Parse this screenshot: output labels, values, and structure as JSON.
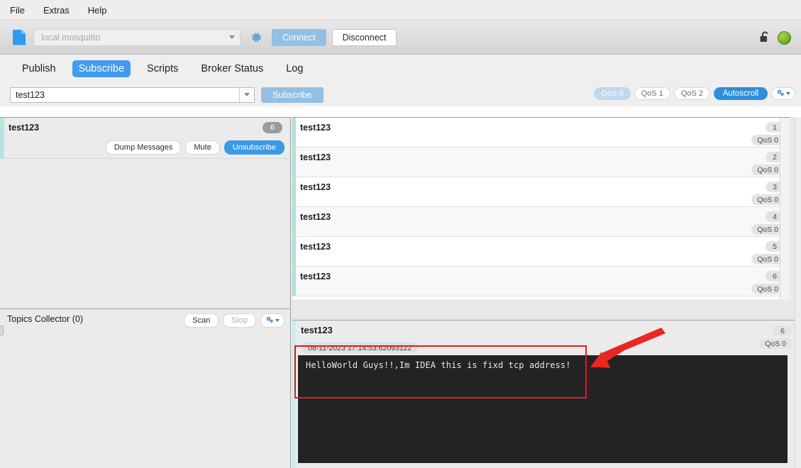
{
  "window": {
    "menu": [
      "File",
      "Extras",
      "Help"
    ]
  },
  "toolbar": {
    "file_icon": "document-icon",
    "broker_value": "local mosquitto",
    "broker_placeholder": "local mosquitto",
    "settings_icon": "gear-icon",
    "connect_label": "Connect",
    "disconnect_label": "Disconnect",
    "lock_icon": "unlocked-padlock-icon",
    "status_icon": "connected-green-dot",
    "status_color": "#7fc02b",
    "accent_color": "#419bf0"
  },
  "tabs": [
    {
      "label": "Publish",
      "active": false
    },
    {
      "label": "Subscribe",
      "active": true
    },
    {
      "label": "Scripts",
      "active": false
    },
    {
      "label": "Broker Status",
      "active": false
    },
    {
      "label": "Log",
      "active": false
    }
  ],
  "subscribe_bar": {
    "topic_value": "test123",
    "subscribe_label": "Subscribe",
    "qos_options": [
      {
        "label": "QoS 0",
        "selected": true
      },
      {
        "label": "QoS 1",
        "selected": false
      },
      {
        "label": "QoS 2",
        "selected": false
      }
    ],
    "autoscroll_label": "Autoscroll",
    "autoscroll_active": true,
    "options_icon": "gear-caret-icon"
  },
  "subscriptions": [
    {
      "topic": "test123",
      "count": "6",
      "actions": [
        {
          "label": "Dump Messages",
          "style": "default"
        },
        {
          "label": "Mute",
          "style": "default"
        },
        {
          "label": "Unsubscribe",
          "style": "blue"
        }
      ]
    }
  ],
  "topics_collector": {
    "title": "Topics Collector (0)",
    "scan_label": "Scan",
    "stop_label": "Stop",
    "stop_disabled": true,
    "options_icon": "gear-caret-icon"
  },
  "messages": [
    {
      "topic": "test123",
      "index": "1",
      "qos": "QoS 0"
    },
    {
      "topic": "test123",
      "index": "2",
      "qos": "QoS 0"
    },
    {
      "topic": "test123",
      "index": "3",
      "qos": "QoS 0"
    },
    {
      "topic": "test123",
      "index": "4",
      "qos": "QoS 0"
    },
    {
      "topic": "test123",
      "index": "5",
      "qos": "QoS 0"
    },
    {
      "topic": "test123",
      "index": "6",
      "qos": "QoS 0"
    }
  ],
  "detail": {
    "topic": "test123",
    "index": "6",
    "qos": "QoS 0",
    "timestamp": "08-11-2023 17:14:53.62093122",
    "payload": "HelloWorld Guys!!,Im IDEA this is fixd tcp address!"
  },
  "annotations": {
    "highlight_color": "#e01b1b",
    "arrow": "red-arrow-pointing-to-payload",
    "rectangle": "red-rectangle-around-payload"
  }
}
